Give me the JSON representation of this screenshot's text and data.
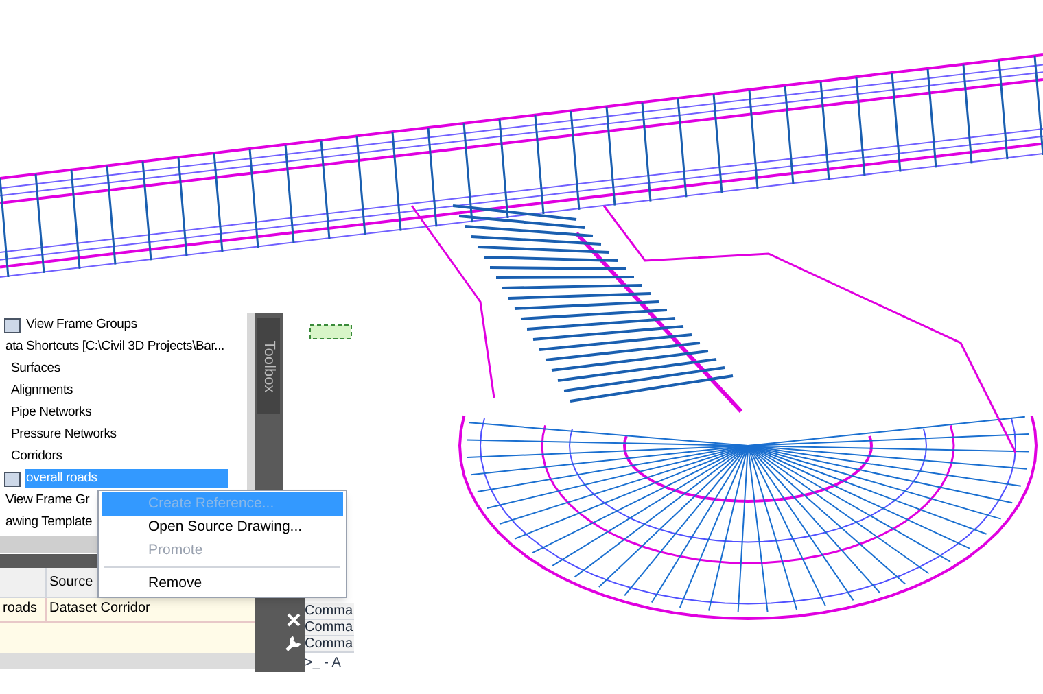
{
  "prospector_tree": [
    {
      "label": "View Frame Groups",
      "icon": true,
      "selected": false
    },
    {
      "label": "ata Shortcuts [C:\\Civil 3D Projects\\Bar...",
      "icon": false,
      "selected": false
    },
    {
      "label": "Surfaces",
      "icon": false,
      "selected": false
    },
    {
      "label": "Alignments",
      "icon": false,
      "selected": false
    },
    {
      "label": "Pipe Networks",
      "icon": false,
      "selected": false
    },
    {
      "label": "Pressure Networks",
      "icon": false,
      "selected": false
    },
    {
      "label": "Corridors",
      "icon": false,
      "selected": false
    },
    {
      "label": "overall roads",
      "icon": true,
      "selected": true
    },
    {
      "label": "View Frame Gr",
      "icon": false,
      "selected": false
    },
    {
      "label": "awing Template",
      "icon": false,
      "selected": false
    }
  ],
  "toolbox": {
    "label": "Toolbox"
  },
  "context_menu": [
    {
      "label": "Create Reference...",
      "disabled": true,
      "selected": true
    },
    {
      "label": "Open Source Drawing...",
      "disabled": false,
      "selected": false
    },
    {
      "label": "Promote",
      "disabled": true,
      "selected": false
    },
    {
      "label": "Remove",
      "disabled": false,
      "selected": false
    }
  ],
  "table": {
    "columns": [
      "",
      "Source"
    ],
    "rows": [
      [
        "roads",
        "Dataset Corridor"
      ]
    ]
  },
  "command_lines": [
    "Comma",
    "Comma",
    "Comma"
  ],
  "command_prompt": ">_ - A"
}
